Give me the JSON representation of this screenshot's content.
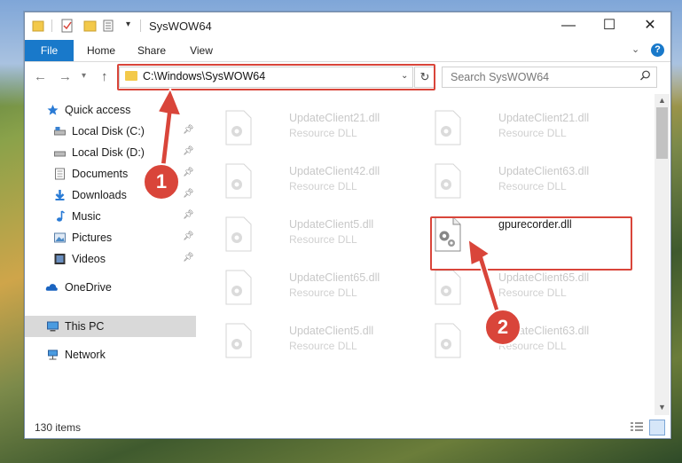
{
  "window": {
    "title": "SysWOW64",
    "controls": {
      "minimize": "—",
      "maximize": "☐",
      "close": "✕"
    }
  },
  "ribbon": {
    "tabs": [
      {
        "label": "File"
      },
      {
        "label": "Home"
      },
      {
        "label": "Share"
      },
      {
        "label": "View"
      }
    ],
    "help": "?"
  },
  "address": {
    "path": "C:\\Windows\\SysWOW64"
  },
  "search": {
    "placeholder": "Search SysWOW64"
  },
  "sidebar": {
    "items": [
      {
        "label": "Quick access",
        "icon": "star-icon"
      },
      {
        "label": "Local Disk (C:)",
        "icon": "drive-icon",
        "pinned": true
      },
      {
        "label": "Local Disk (D:)",
        "icon": "drive-icon",
        "pinned": true
      },
      {
        "label": "Documents",
        "icon": "documents-icon",
        "pinned": true
      },
      {
        "label": "Downloads",
        "icon": "downloads-icon",
        "pinned": true
      },
      {
        "label": "Music",
        "icon": "music-icon",
        "pinned": true
      },
      {
        "label": "Pictures",
        "icon": "pictures-icon",
        "pinned": true
      },
      {
        "label": "Videos",
        "icon": "videos-icon",
        "pinned": true
      },
      {
        "label": "OneDrive",
        "icon": "cloud-icon"
      },
      {
        "label": "This PC",
        "icon": "computer-icon",
        "selected": true
      },
      {
        "label": "Network",
        "icon": "network-icon"
      }
    ]
  },
  "files": [
    {
      "name": "UpdateClient21.dll",
      "type": "Resource DLL"
    },
    {
      "name": "UpdateClient21.dll",
      "type": "Resource DLL"
    },
    {
      "name": "UpdateClient42.dll",
      "type": "Resource DLL"
    },
    {
      "name": "UpdateClient63.dll",
      "type": "Resource DLL"
    },
    {
      "name": "UpdateClient5.dll",
      "type": "Resource DLL"
    },
    {
      "name": "gpurecorder.dll",
      "type": "",
      "focused": true
    },
    {
      "name": "UpdateClient65.dll",
      "type": "Resource DLL"
    },
    {
      "name": "UpdateClient65.dll",
      "type": "Resource DLL"
    },
    {
      "name": "UpdateClient5.dll",
      "type": "Resource DLL"
    },
    {
      "name": "UpdateClient63.dll",
      "type": "Resource DLL"
    }
  ],
  "status": {
    "item_count": "130 items"
  },
  "callouts": [
    {
      "number": "1"
    },
    {
      "number": "2"
    }
  ],
  "colors": {
    "accent": "#1979ca",
    "highlight": "#d9453a"
  }
}
